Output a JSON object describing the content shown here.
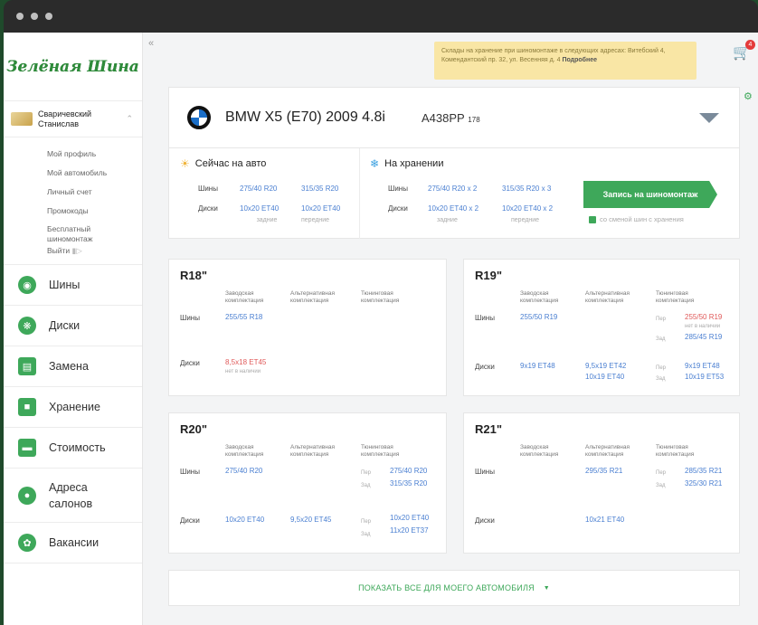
{
  "logo_text": "Зелёная Шина",
  "user": {
    "name_line1": "Сваричевский",
    "name_line2": "Станислав"
  },
  "profile_menu": [
    "Мой профиль",
    "Мой автомобиль",
    "Личный счет",
    "Промокоды",
    "Бесплатный шиномонтаж"
  ],
  "logout_label": "Выйти",
  "nav": [
    {
      "label": "Шины",
      "icon": "tire-icon"
    },
    {
      "label": "Диски",
      "icon": "wheel-icon"
    },
    {
      "label": "Замена",
      "icon": "car-lift-icon"
    },
    {
      "label": "Хранение",
      "icon": "garage-icon"
    },
    {
      "label": "Стоимость",
      "icon": "car-icon"
    },
    {
      "label": "Адреса салонов",
      "icon": "map-pin-icon"
    },
    {
      "label": "Вакансии",
      "icon": "wrench-person-icon"
    }
  ],
  "notice": {
    "text": "Склады на хранение при шиномонтаже в следующих адресах: Витебский 4, Комендантский пр. 32, ул. Весенняя д. 4",
    "link": "Подробнее"
  },
  "cart_count": "4",
  "car": {
    "name": "BMW X5 (E70) 2009 4.8i",
    "plate": "А438РР",
    "region": "178"
  },
  "on_car": {
    "title": "Сейчас на авто",
    "tires_label": "Шины",
    "tires_front": "275/40 R20",
    "tires_rear": "315/35 R20",
    "rims_label": "Диски",
    "rims_front": "10x20 ET40",
    "rims_rear": "10x20 ET40",
    "rims_front_note": "задние",
    "rims_rear_note": "передние"
  },
  "storage": {
    "title": "На хранении",
    "tires_label": "Шины",
    "tires_front": "275/40 R20 x 2",
    "tires_rear": "315/35 R20 x 3",
    "rims_label": "Диски",
    "rims_front": "10x20 ET40 x 2",
    "rims_rear": "10x20 ET40 x 2",
    "rims_front_note": "задние",
    "rims_rear_note": "передние"
  },
  "book_button": "Запись на шиномонтаж",
  "swap_checkbox": "со сменой шин с хранения",
  "col_headers": {
    "factory": "Заводская комплектация",
    "alt": "Альтернативная комплектация",
    "tuning": "Тюнинговая комплектация"
  },
  "row_labels": {
    "tires": "Шины",
    "rims": "Диски"
  },
  "axle_labels": {
    "front": "Пер",
    "rear": "Зад"
  },
  "r18": {
    "title": "R18\"",
    "tire_factory": "255/55 R18",
    "rim_factory": "8,5x18 ET45",
    "rim_factory_note": "нет в наличии"
  },
  "r19": {
    "title": "R19\"",
    "tire_factory": "255/50 R19",
    "tire_tuning_front": "255/50 R19",
    "tire_tuning_front_note": "нет в наличии",
    "tire_tuning_rear": "285/45 R19",
    "rim_factory": "9x19 ET48",
    "rim_alt_1": "9,5x19 ET42",
    "rim_alt_2": "10x19 ET40",
    "rim_tuning_front": "9x19 ET48",
    "rim_tuning_rear": "10x19 ET53"
  },
  "r20": {
    "title": "R20\"",
    "tire_factory": "275/40 R20",
    "tire_tuning_front": "275/40 R20",
    "tire_tuning_rear": "315/35 R20",
    "rim_factory": "10x20 ET40",
    "rim_alt": "9,5x20 ET45",
    "rim_tuning_front": "10x20 ET40",
    "rim_tuning_rear": "11x20 ET37"
  },
  "r21": {
    "title": "R21\"",
    "tire_alt": "295/35 R21",
    "tire_tuning_front": "285/35 R21",
    "tire_tuning_rear": "325/30 R21",
    "rim_alt": "10x21 ET40"
  },
  "show_all": "ПОКАЗАТЬ ВСЕ ДЛЯ МОЕГО АВТОМОБИЛЯ"
}
